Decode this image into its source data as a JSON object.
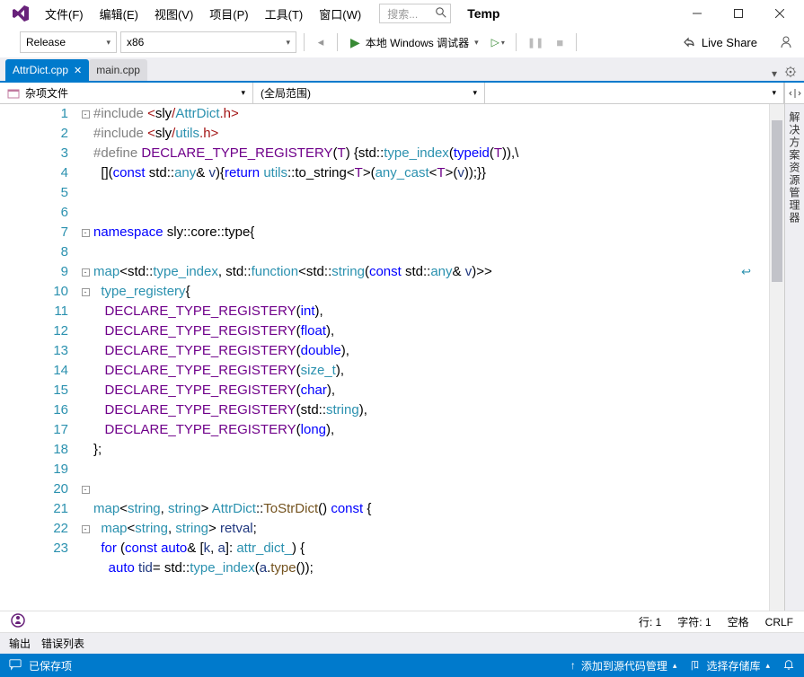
{
  "menu": {
    "file": "文件(F)",
    "edit": "编辑(E)",
    "view": "视图(V)",
    "project": "项目(P)",
    "tools": "工具(T)",
    "window": "窗口(W)"
  },
  "search": {
    "placeholder": "搜索..."
  },
  "titleText": "Temp",
  "toolbar": {
    "config": "Release",
    "platform": "x86",
    "debugger": "本地 Windows 调试器",
    "liveShare": "Live Share"
  },
  "tabs": {
    "active": "AttrDict.cpp",
    "other": "main.cpp"
  },
  "context": {
    "scope1": "杂项文件",
    "scope2": "(全局范围)"
  },
  "rightPanel": "解决方案资源管理器",
  "editorStatus": {
    "line": "行: 1",
    "col": "字符: 1",
    "ins": "空格",
    "eol": "CRLF"
  },
  "bottomTabs": {
    "output": "输出",
    "errors": "错误列表"
  },
  "statusBar": {
    "saved": "已保存项",
    "addSource": "添加到源代码管理",
    "selectRepo": "选择存储库"
  },
  "code": [
    "#include <sly/AttrDict.h>",
    "#include <sly/utils.h>",
    "#define DECLARE_TYPE_REGISTERY(T) {std::type_index(typeid(T)),\\",
    "  [](const std::any& v){return utils::to_string<T>(any_cast<T>(v));}}",
    "",
    "",
    "namespace sly::core::type{",
    "",
    "map<std::type_index, std::function<std::string(const std::any& v)>>",
    "  type_registery{",
    "   DECLARE_TYPE_REGISTERY(int),",
    "   DECLARE_TYPE_REGISTERY(float),",
    "   DECLARE_TYPE_REGISTERY(double),",
    "   DECLARE_TYPE_REGISTERY(size_t),",
    "   DECLARE_TYPE_REGISTERY(char),",
    "   DECLARE_TYPE_REGISTERY(std::string),",
    "   DECLARE_TYPE_REGISTERY(long),",
    "};",
    "",
    "",
    "map<string, string> AttrDict::ToStrDict() const {",
    "  map<string, string> retval;",
    "  for (const auto& [k, a]: attr_dict_) {",
    "    auto tid= std::type_index(a.type());"
  ],
  "lineNumbers": [
    "1",
    "2",
    "3",
    "4",
    "5",
    "6",
    "7",
    "8",
    "9",
    "10",
    "11",
    "12",
    "13",
    "14",
    "15",
    "16",
    "17",
    "18",
    "19",
    "20",
    "21",
    "22",
    "23"
  ]
}
